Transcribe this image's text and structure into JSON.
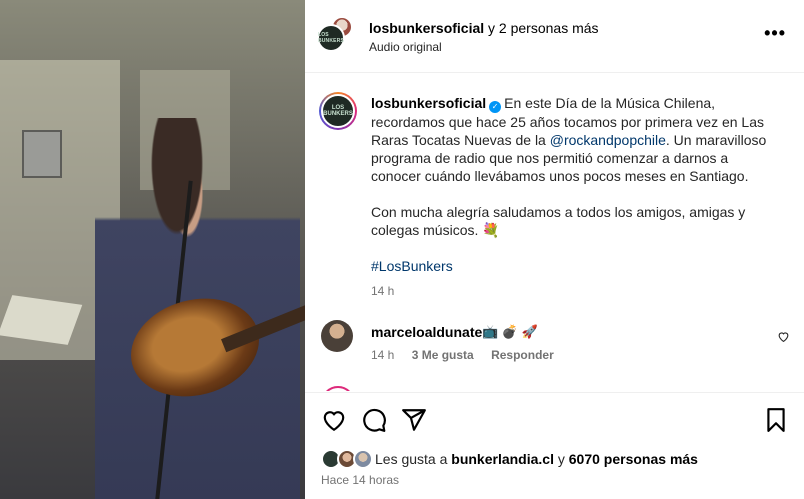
{
  "header": {
    "username": "losbunkersoficial",
    "others": "y 2 personas más",
    "audio": "Audio original",
    "avatar_text": "LOS BUNKERS"
  },
  "caption": {
    "username": "losbunkersoficial",
    "text1": "En este Día de la Música Chilena, recordamos que hace 25 años tocamos por primera vez en Las Raras Tocatas Nuevas de la",
    "mention": "@rockandpopchile",
    "text2": ". Un maravilloso programa de radio que nos permitió comenzar a darnos a conocer cuándo llevábamos unos pocos meses en Santiago.",
    "text3": "Con mucha alegría saludamos a todos los amigos, amigas y colegas músicos. 💐",
    "hashtag": "#LosBunkers",
    "time": "14 h"
  },
  "comment": {
    "username": "marceloaldunate",
    "text": "📺 💣 🚀",
    "time": "14 h",
    "likes": "3 Me gusta",
    "reply": "Responder"
  },
  "footer": {
    "likes_prefix": "Les gusta a ",
    "likes_user": "bunkerlandia.cl",
    "likes_mid": " y ",
    "likes_count": "6070 personas más",
    "ago": "Hace 14 horas"
  },
  "colors": {
    "link": "#00376b",
    "muted": "#737373",
    "verified": "#0095f6"
  }
}
